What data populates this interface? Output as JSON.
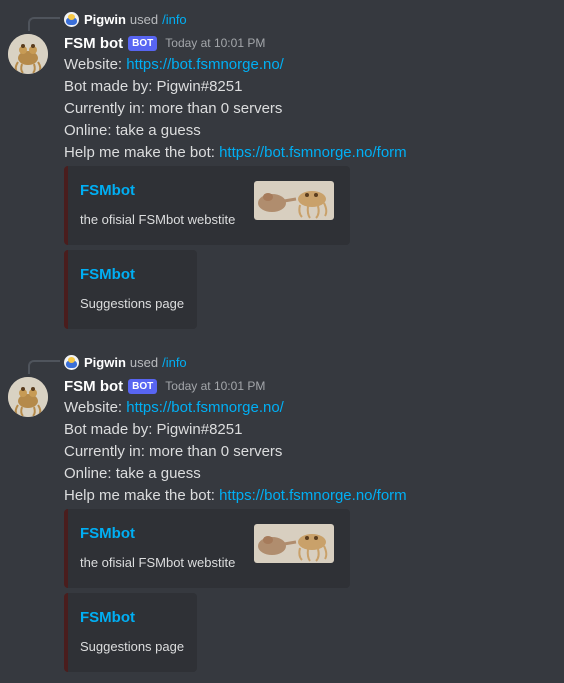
{
  "messages": [
    {
      "reply": {
        "user": "Pigwin",
        "used": "used",
        "command": "/info"
      },
      "author": {
        "name": "FSM bot",
        "tag": "BOT",
        "timestamp": "Today at 10:01 PM"
      },
      "lines": [
        {
          "label": "Website: ",
          "link": "https://bot.fsmnorge.no/"
        },
        {
          "label": "Bot made by: Pigwin#8251",
          "link": ""
        },
        {
          "label": "Currently in: more than 0 servers",
          "link": ""
        },
        {
          "label": "Online: take a guess",
          "link": ""
        },
        {
          "label": "Help me make the bot: ",
          "link": "https://bot.fsmnorge.no/form"
        }
      ],
      "embeds": [
        {
          "title": "FSMbot",
          "description": "the ofisial FSMbot webstite",
          "thumbnail": "creation-of-adam-fsm"
        },
        {
          "title": "FSMbot",
          "description": "Suggestions page"
        }
      ]
    },
    {
      "reply": {
        "user": "Pigwin",
        "used": "used",
        "command": "/info"
      },
      "author": {
        "name": "FSM bot",
        "tag": "BOT",
        "timestamp": "Today at 10:01 PM"
      },
      "lines": [
        {
          "label": "Website: ",
          "link": "https://bot.fsmnorge.no/"
        },
        {
          "label": "Bot made by: Pigwin#8251",
          "link": ""
        },
        {
          "label": "Currently in: more than 0 servers",
          "link": ""
        },
        {
          "label": "Online: take a guess",
          "link": ""
        },
        {
          "label": "Help me make the bot: ",
          "link": "https://bot.fsmnorge.no/form"
        }
      ],
      "embeds": [
        {
          "title": "FSMbot",
          "description": "the ofisial FSMbot webstite",
          "thumbnail": "creation-of-adam-fsm"
        },
        {
          "title": "FSMbot",
          "description": "Suggestions page"
        }
      ]
    }
  ],
  "colors": {
    "background": "#36393f",
    "embed_bg": "#2f3136",
    "link": "#00aff4",
    "bot_tag": "#5865f2",
    "embed_border": "#4a1d1d"
  }
}
